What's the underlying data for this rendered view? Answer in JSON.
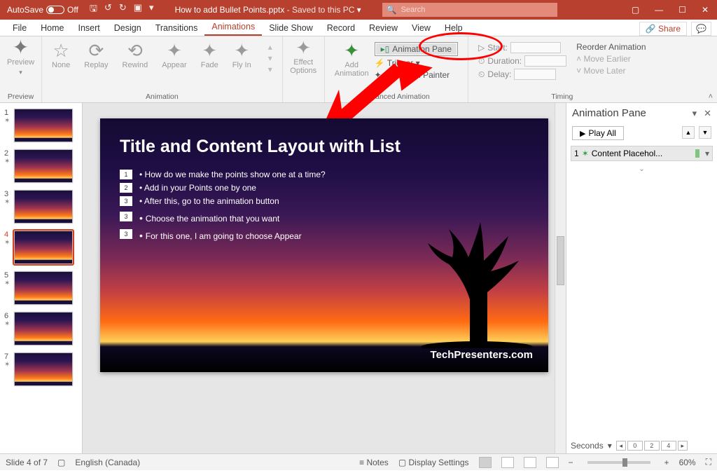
{
  "title_bar": {
    "autosave_label": "AutoSave",
    "autosave_state": "Off",
    "doc_name": "How to add Bullet Points.pptx",
    "saved_text": " -  Saved to this PC",
    "search_placeholder": "Search"
  },
  "tabs": [
    "File",
    "Home",
    "Insert",
    "Design",
    "Transitions",
    "Animations",
    "Slide Show",
    "Record",
    "Review",
    "View",
    "Help"
  ],
  "active_tab": "Animations",
  "share_label": "Share",
  "ribbon": {
    "preview": {
      "btn": "Preview",
      "group": "Preview"
    },
    "anim_items": [
      "None",
      "Replay",
      "Rewind",
      "Appear",
      "Fade",
      "Fly In"
    ],
    "anim_group": "Animation",
    "effect_options": "Effect\nOptions",
    "advanced": {
      "add_anim": "Add\nAnimation",
      "pane_btn": "Animation Pane",
      "trigger": "Trigger",
      "painter": "Animation Painter",
      "group": "Advanced Animation"
    },
    "timing": {
      "start": "Start:",
      "duration": "Duration:",
      "delay": "Delay:",
      "reorder": "Reorder Animation",
      "earlier": "Move Earlier",
      "later": "Move Later",
      "group": "Timing"
    }
  },
  "slide": {
    "title": "Title and Content Layout with List",
    "bullets": [
      {
        "n": "1",
        "t": "How do we make the points show one at a time?"
      },
      {
        "n": "2",
        "t": "Add in your Points one by one"
      },
      {
        "n": "3",
        "t": "After this, go to the animation button"
      }
    ],
    "subs": [
      "Choose the animation that you want",
      "For this one, I am going to choose Appear"
    ],
    "sub_tag": "3",
    "brand": "TechPresenters.com"
  },
  "anim_pane": {
    "title": "Animation Pane",
    "play": "Play All",
    "item_idx": "1",
    "item_label": "Content Placehol...",
    "seconds": "Seconds",
    "tl": [
      "0",
      "2",
      "4"
    ]
  },
  "status": {
    "slide": "Slide 4 of 7",
    "lang": "English (Canada)",
    "notes": "Notes",
    "display": "Display Settings",
    "zoom": "60%"
  },
  "thumb_count": 7,
  "selected_thumb": 4
}
